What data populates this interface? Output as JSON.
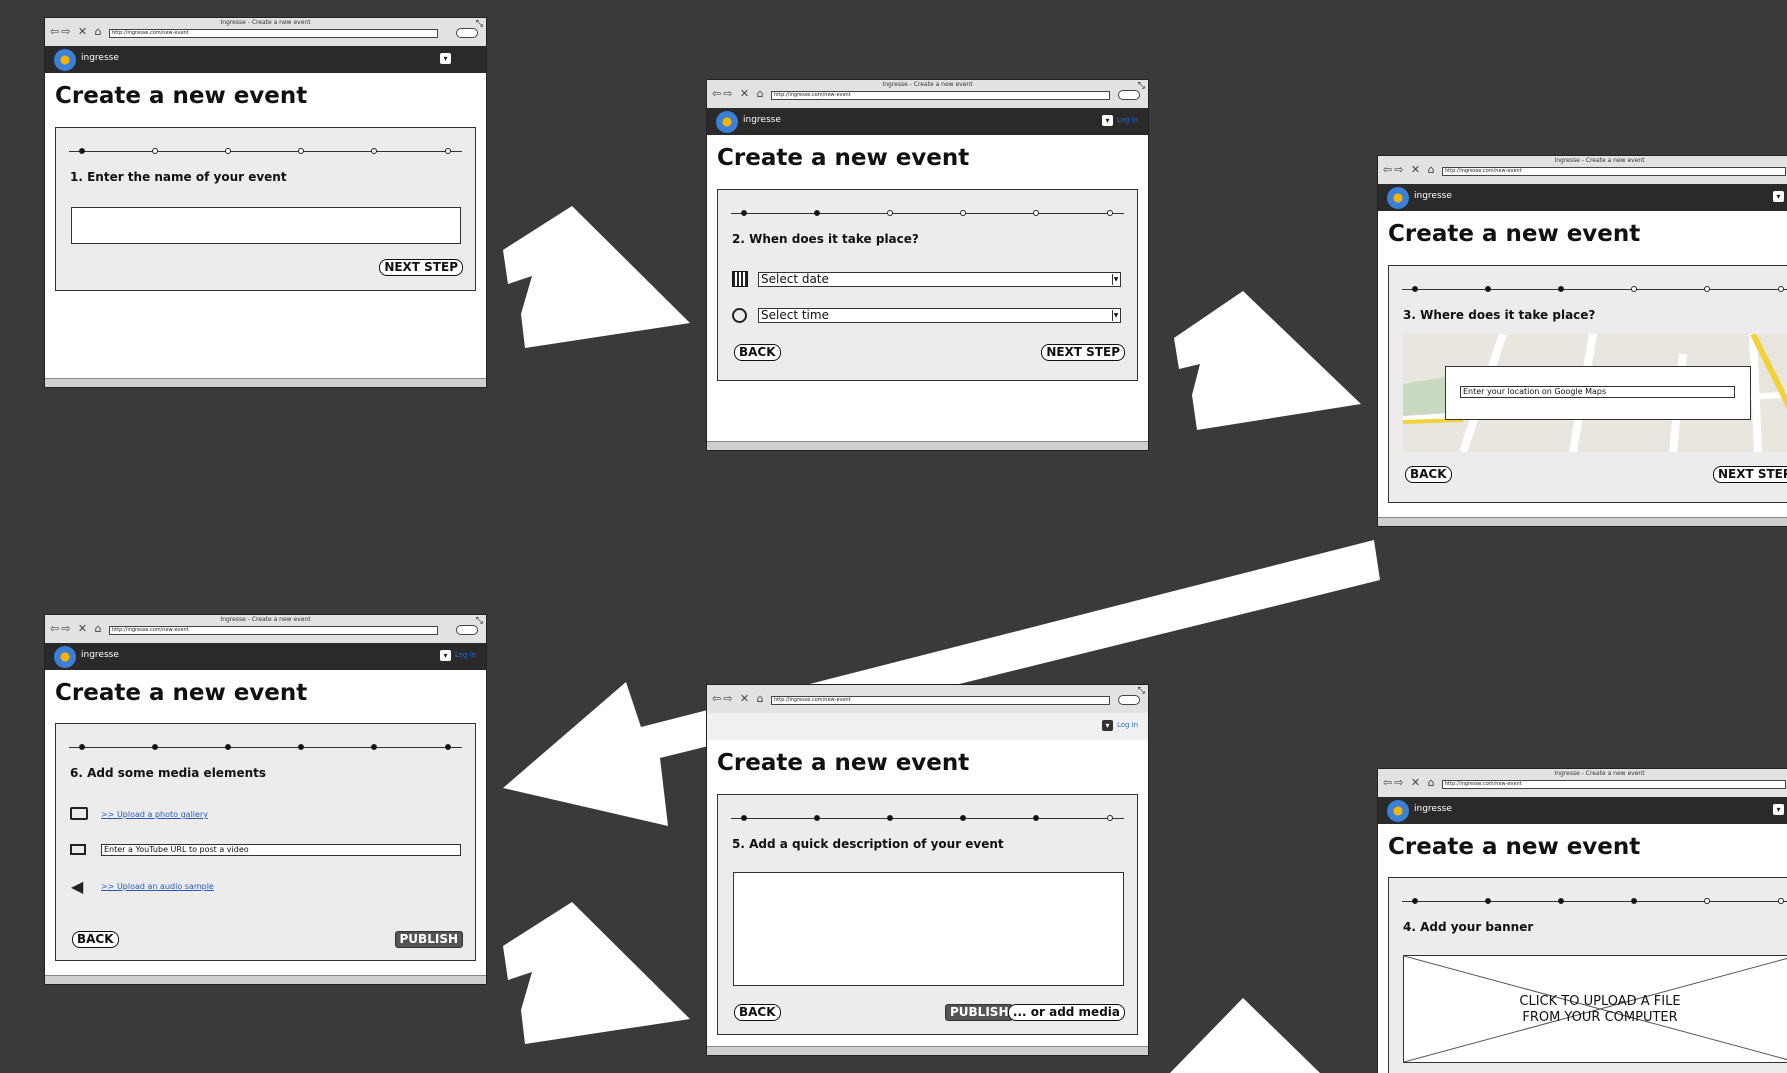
{
  "browser": {
    "window_title": "Ingresse - Create a new event",
    "url": "http://ingresse.com/new-event",
    "nav_glyphs": "⇦⇨ ✕ ⌂",
    "resize_glyph": "⤡",
    "message_glyph": "▾"
  },
  "app": {
    "brand": "ingresse",
    "page_title": "Create a new event",
    "login_label": "Log in"
  },
  "buttons": {
    "next": "NEXT STEP",
    "back": "BACK",
    "publish": "PUBLISH",
    "add_media": "... or add media"
  },
  "steps": {
    "s1": {
      "label": "1. Enter the name of your event",
      "name_value": ""
    },
    "s2": {
      "label": "2. When does it take place?",
      "date_placeholder": "Select date",
      "time_placeholder": "Select time"
    },
    "s3": {
      "label": "3. Where does it take place?",
      "location_placeholder": "Enter your location on Google Maps"
    },
    "s4": {
      "label": "4. Add your banner",
      "upload_text_1": "CLICK TO UPLOAD A FILE",
      "upload_text_2": "FROM YOUR COMPUTER"
    },
    "s5": {
      "label": "5. Add a quick description of your event",
      "description_value": ""
    },
    "s6": {
      "label": "6. Add some media elements",
      "photo_link": ">> Upload a photo gallery",
      "video_placeholder": "Enter a YouTube URL to post a video",
      "audio_link": ">> Upload an audio sample"
    }
  },
  "icons": {
    "calendar": "calendar-icon",
    "clock": "clock-icon",
    "camera": "camera-icon",
    "video": "video-camera-icon",
    "speaker": "speaker-icon",
    "message": "message-icon",
    "logo": "ingresse-logo-icon"
  },
  "colors": {
    "background": "#3a3a3a",
    "appbar": "#2a2a2a",
    "panel": "#ececec",
    "link": "#2a5ab0",
    "arrow": "#ffffff"
  }
}
